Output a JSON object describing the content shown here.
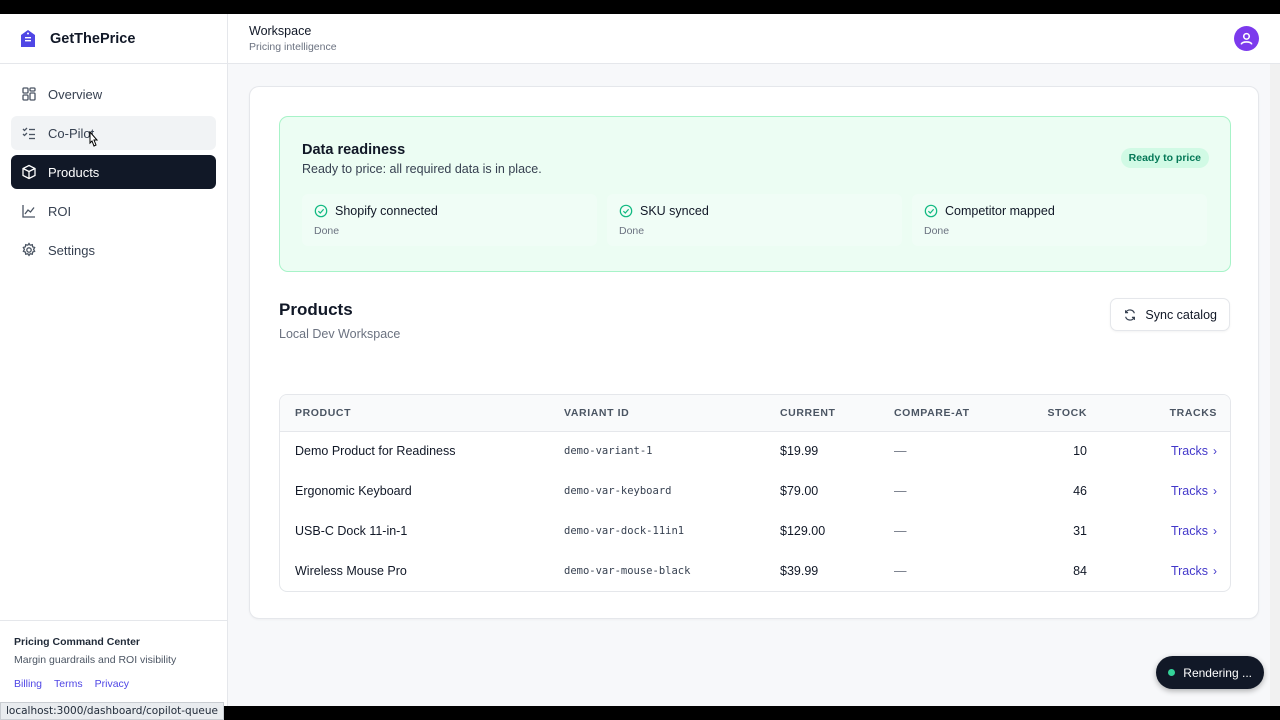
{
  "brand": {
    "name": "GetThePrice",
    "logo_icon": "house-tag-icon",
    "accent": "#4f46e5"
  },
  "sidebar": {
    "items": [
      {
        "label": "Overview",
        "icon": "grid-icon",
        "state": "default"
      },
      {
        "label": "Co-Pilot",
        "icon": "checklist-icon",
        "state": "hover"
      },
      {
        "label": "Products",
        "icon": "box-icon",
        "state": "active"
      },
      {
        "label": "ROI",
        "icon": "line-chart-icon",
        "state": "default"
      },
      {
        "label": "Settings",
        "icon": "gear-icon",
        "state": "default"
      }
    ],
    "footer": {
      "title": "Pricing Command Center",
      "subtitle": "Margin guardrails and ROI visibility",
      "links": [
        "Billing",
        "Terms",
        "Privacy"
      ]
    }
  },
  "header": {
    "title": "Workspace",
    "subtitle": "Pricing intelligence"
  },
  "readiness": {
    "title": "Data readiness",
    "subtitle": "Ready to price: all required data is in place.",
    "badge": "Ready to price",
    "steps": [
      {
        "label": "Shopify connected",
        "state": "Done"
      },
      {
        "label": "SKU synced",
        "state": "Done"
      },
      {
        "label": "Competitor mapped",
        "state": "Done"
      }
    ]
  },
  "products": {
    "title": "Products",
    "subtitle": "Local Dev Workspace",
    "sync_label": "Sync catalog",
    "columns": [
      "PRODUCT",
      "VARIANT ID",
      "CURRENT",
      "COMPARE-AT",
      "STOCK",
      "TRACKS"
    ],
    "rows": [
      {
        "product": "Demo Product for Readiness",
        "variant": "demo-variant-1",
        "current": "$19.99",
        "compare": "—",
        "stock": "10",
        "tracks": "Tracks"
      },
      {
        "product": "Ergonomic Keyboard",
        "variant": "demo-var-keyboard",
        "current": "$79.00",
        "compare": "—",
        "stock": "46",
        "tracks": "Tracks"
      },
      {
        "product": "USB-C Dock 11-in-1",
        "variant": "demo-var-dock-11in1",
        "current": "$129.00",
        "compare": "—",
        "stock": "31",
        "tracks": "Tracks"
      },
      {
        "product": "Wireless Mouse Pro",
        "variant": "demo-var-mouse-black",
        "current": "$39.99",
        "compare": "—",
        "stock": "84",
        "tracks": "Tracks"
      }
    ]
  },
  "status_bar": {
    "url": "localhost:3000/dashboard/copilot-queue"
  },
  "toast": {
    "label": "Rendering ..."
  }
}
